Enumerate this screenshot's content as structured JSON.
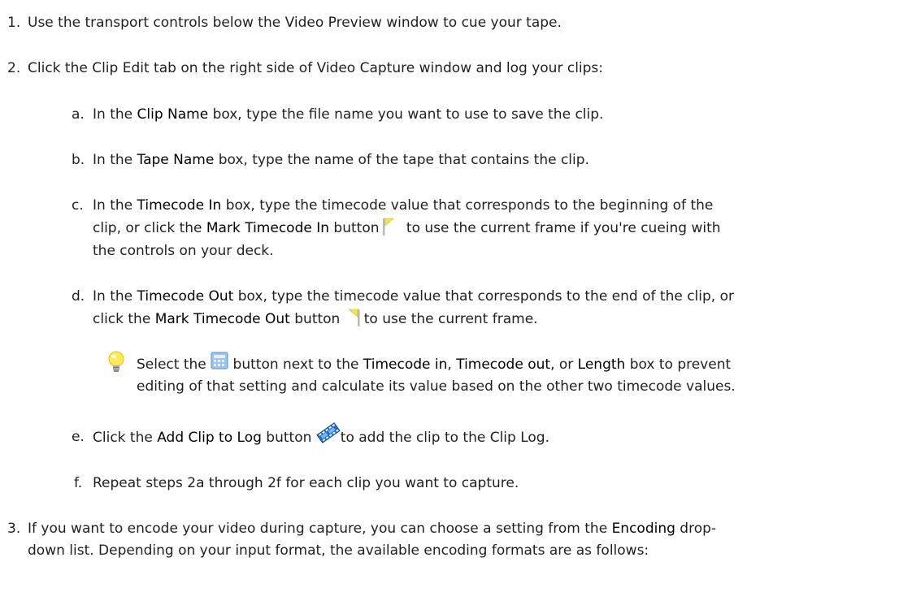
{
  "steps": [
    {
      "num": "1.",
      "text": "Use the transport controls below the Video Preview window to cue your tape."
    },
    {
      "num": "2.",
      "text": "Click the Clip Edit tab on the right side of Video Capture window and log your clips:"
    },
    {
      "num": "3.",
      "line1_a": "If you want to encode your video during capture, you can choose a setting from the ",
      "line1_b": "Encoding",
      "line1_c": " drop-",
      "line2": "down list. Depending on your input format, the available encoding formats are as follows:"
    }
  ],
  "substeps": {
    "a": {
      "num": "a.",
      "pre": "In the ",
      "term": "Clip Name",
      "post": " box, type the file name you want to use to save the clip."
    },
    "b": {
      "num": "b.",
      "pre": "In the ",
      "term": "Tape Name",
      "post": " box, type the name of the tape that contains the clip."
    },
    "c": {
      "num": "c.",
      "l1_pre": "In the ",
      "l1_term": "Timecode In",
      "l1_post": " box, type the timecode value that corresponds to the beginning of the",
      "l2_pre": "clip, or click the ",
      "l2_term": "Mark Timecode In",
      "l2_mid": " button",
      "l2_post": " to use the current frame if you're cueing with",
      "l3": "the controls on your deck."
    },
    "d": {
      "num": "d.",
      "l1_pre": "In the ",
      "l1_term": "Timecode Out",
      "l1_post": " box, type the timecode value that corresponds to the end of the clip, or",
      "l2_pre": "click the ",
      "l2_term": "Mark Timecode Out",
      "l2_mid": " button ",
      "l2_post": "to use the current frame."
    },
    "tip": {
      "l1_pre": "Select the ",
      "l1_mid": " button next to the ",
      "l1_t1": "Timecode in",
      "l1_c1": ", ",
      "l1_t2": "Timecode out",
      "l1_c2": ", or ",
      "l1_t3": "Length",
      "l1_post": " box to prevent",
      "l2": "editing of that setting and calculate its value based on the other two timecode values."
    },
    "e": {
      "num": "e.",
      "pre": "Click the ",
      "term": "Add Clip to Log",
      "mid": " button ",
      "post": "to add the clip to the Clip Log."
    },
    "f": {
      "num": "f.",
      "text": "Repeat steps 2a through 2f for each clip you want to capture."
    }
  },
  "icons": [
    "mark-in-flag-icon",
    "mark-out-flag-icon",
    "lock-calculator-icon",
    "add-clip-film-icon",
    "lightbulb-icon"
  ]
}
